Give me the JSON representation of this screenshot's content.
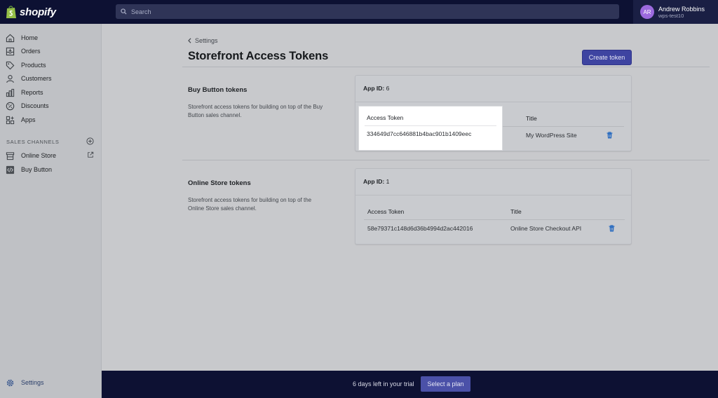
{
  "topbar": {
    "logo_text": "shopify",
    "search_placeholder": "Search",
    "user": {
      "initials": "AR",
      "name": "Andrew Robbins",
      "store": "wps-test10"
    }
  },
  "sidebar": {
    "items": [
      {
        "label": "Home",
        "icon": "home-icon"
      },
      {
        "label": "Orders",
        "icon": "orders-icon"
      },
      {
        "label": "Products",
        "icon": "tag-icon"
      },
      {
        "label": "Customers",
        "icon": "person-icon"
      },
      {
        "label": "Reports",
        "icon": "bar-chart-icon"
      },
      {
        "label": "Discounts",
        "icon": "discount-icon"
      },
      {
        "label": "Apps",
        "icon": "apps-icon"
      }
    ],
    "channels_label": "SALES CHANNELS",
    "channels": [
      {
        "label": "Online Store",
        "icon": "store-icon"
      },
      {
        "label": "Buy Button",
        "icon": "code-icon"
      }
    ],
    "settings_label": "Settings"
  },
  "main": {
    "breadcrumb": "Settings",
    "title": "Storefront Access Tokens",
    "create_button": "Create token",
    "sections": [
      {
        "title": "Buy Button tokens",
        "description": "Storefront access tokens for building on top of the Buy Button sales channel.",
        "app_id_label": "App ID:",
        "app_id": "6",
        "col_token": "Access Token",
        "col_title": "Title",
        "token": "334649d7cc646881b4bac901b1409eec",
        "token_title": "My WordPress Site"
      },
      {
        "title": "Online Store tokens",
        "description": "Storefront access tokens for building on top of the Online Store sales channel.",
        "app_id_label": "App ID:",
        "app_id": "1",
        "col_token": "Access Token",
        "col_title": "Title",
        "token": "58e79371c148d6d36b4994d2ac442016",
        "token_title": "Online Store Checkout API"
      }
    ]
  },
  "footer": {
    "trial_text": "6 days left in your trial",
    "plan_button": "Select a plan"
  },
  "colors": {
    "topbar": "#0d1133",
    "primary": "#3e44a1",
    "trash": "#2a6cc0"
  }
}
